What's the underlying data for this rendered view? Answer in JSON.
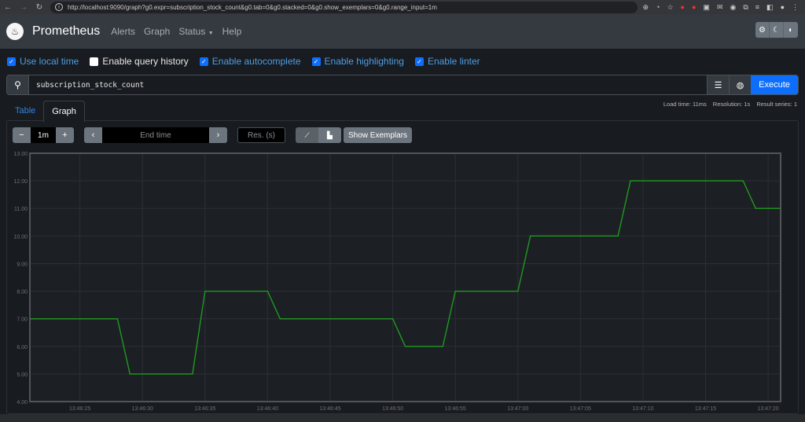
{
  "browser": {
    "url": "http://localhost:9090/graph?g0.expr=subscription_stock_count&g0.tab=0&g0.stacked=0&g0.show_exemplars=0&g0.range_input=1m",
    "nav_icons": [
      "back-icon",
      "forward-icon",
      "reload-icon"
    ],
    "extension_icons": [
      "zoom-icon",
      "performance-icon",
      "bookmark-star-icon",
      "extension-red-icon",
      "extension-t-icon",
      "extension-square-icon",
      "extension-mail-icon",
      "extension-glasses-icon",
      "extensions-puzzle-icon",
      "reading-list-icon",
      "sidebar-icon",
      "profile-avatar",
      "menu-icon"
    ]
  },
  "navbar": {
    "brand": "Prometheus",
    "links": [
      "Alerts",
      "Graph",
      "Status",
      "Help"
    ],
    "theme_buttons": [
      "gear-icon",
      "moon-icon",
      "contrast-icon"
    ]
  },
  "options": [
    {
      "label": "Use local time",
      "checked": true
    },
    {
      "label": "Enable query history",
      "checked": false
    },
    {
      "label": "Enable autocomplete",
      "checked": true
    },
    {
      "label": "Enable highlighting",
      "checked": true
    },
    {
      "label": "Enable linter",
      "checked": true
    }
  ],
  "query": {
    "expression": "subscription_stock_count",
    "execute_label": "Execute"
  },
  "stats": {
    "load_time": "Load time: 11ms",
    "resolution": "Resolution: 1s",
    "result_series": "Result series: 1"
  },
  "tabs": [
    {
      "label": "Table",
      "active": false
    },
    {
      "label": "Graph",
      "active": true
    }
  ],
  "controls": {
    "range": "1m",
    "minus": "−",
    "plus": "+",
    "end_time_placeholder": "End time",
    "prev": "‹",
    "next": "›",
    "resolution_placeholder": "Res. (s)",
    "show_exemplars": "Show Exemplars"
  },
  "chart_data": {
    "type": "line",
    "title": "",
    "xlabel": "",
    "ylabel": "",
    "series": [
      {
        "name": "subscription_stock_count",
        "color": "#1f9a1f",
        "x": [
          "13:46:21",
          "13:46:28",
          "13:46:29",
          "13:46:34",
          "13:46:35",
          "13:46:40",
          "13:46:41",
          "13:46:50",
          "13:46:51",
          "13:46:54",
          "13:46:55",
          "13:47:00",
          "13:47:01",
          "13:47:08",
          "13:47:09",
          "13:47:18",
          "13:47:19",
          "13:47:21"
        ],
        "values": [
          7,
          7,
          5,
          5,
          8,
          8,
          7,
          7,
          6,
          6,
          8,
          8,
          10,
          10,
          12,
          12,
          11,
          11
        ]
      }
    ],
    "x_ticks": [
      "13:46:25",
      "13:46:30",
      "13:46:35",
      "13:46:40",
      "13:46:45",
      "13:46:50",
      "13:46:55",
      "13:47:00",
      "13:47:05",
      "13:47:10",
      "13:47:15",
      "13:47:20"
    ],
    "y_ticks": [
      "4.00",
      "5.00",
      "6.00",
      "7.00",
      "8.00",
      "9.00",
      "10.00",
      "11.00",
      "12.00",
      "13.00"
    ],
    "xlim": [
      "13:46:21",
      "13:47:21"
    ],
    "ylim": [
      4,
      13
    ],
    "grid": true,
    "legend": "none"
  }
}
